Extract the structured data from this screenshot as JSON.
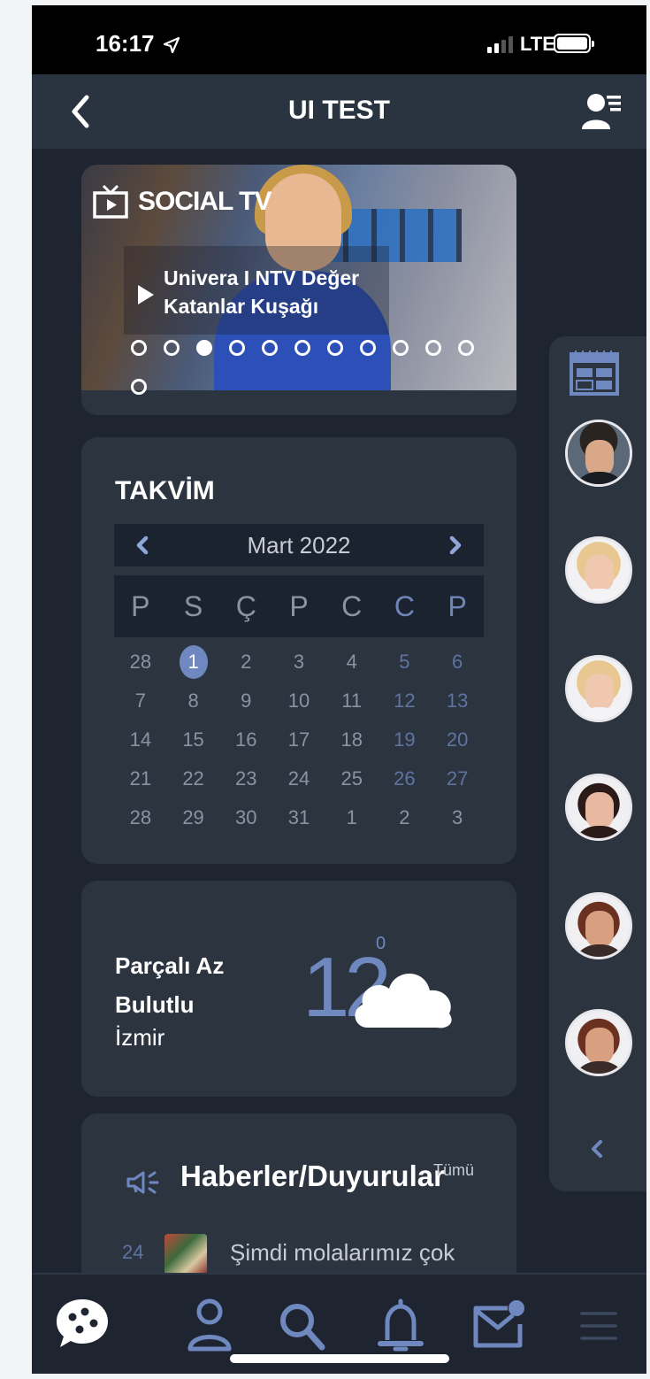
{
  "status_bar": {
    "time": "16:17",
    "network": "LTE"
  },
  "navbar": {
    "title": "UI TEST",
    "back_icon": "chevron-left-icon",
    "profile_icon": "user-list-icon"
  },
  "social_tv": {
    "logo_text": "SOCIAL TV",
    "caption_line1": "Univera I NTV Değer",
    "caption_line2": "Katanlar Kuşağı",
    "slide_count": 12,
    "active_slide": 3
  },
  "calendar": {
    "title": "TAKVİM",
    "month_label": "Mart 2022",
    "weekdays": [
      "P",
      "S",
      "Ç",
      "P",
      "C",
      "C",
      "P"
    ],
    "days": [
      "28",
      "1",
      "2",
      "3",
      "4",
      "5",
      "6",
      "7",
      "8",
      "9",
      "10",
      "11",
      "12",
      "13",
      "14",
      "15",
      "16",
      "17",
      "18",
      "19",
      "20",
      "21",
      "22",
      "23",
      "24",
      "25",
      "26",
      "27",
      "28",
      "29",
      "30",
      "31",
      "1",
      "2",
      "3"
    ],
    "today": "1"
  },
  "weather": {
    "condition_line1": "Parçalı Az",
    "condition_line2": "Bulutlu",
    "city": "İzmir",
    "temperature": "12",
    "degree_symbol": "0",
    "icon": "cloud-icon"
  },
  "news": {
    "title": "Haberler/Duyurular",
    "all_link": "Tümü",
    "items": [
      {
        "day": "24",
        "text": "Şimdi molalarımız çok"
      }
    ]
  },
  "side_panel": {
    "calendar_icon": "calendar-icon",
    "avatar_count": 6,
    "collapse_icon": "chevron-left-icon"
  },
  "tabbar": {
    "items": [
      "chat-bubble-icon",
      "user-icon",
      "search-icon",
      "bell-icon",
      "mail-icon",
      "menu-icon"
    ]
  },
  "colors": {
    "background": "#1f2530",
    "card": "#2c3440",
    "accent": "#6f88c0",
    "weekend": "#5e73a0"
  }
}
